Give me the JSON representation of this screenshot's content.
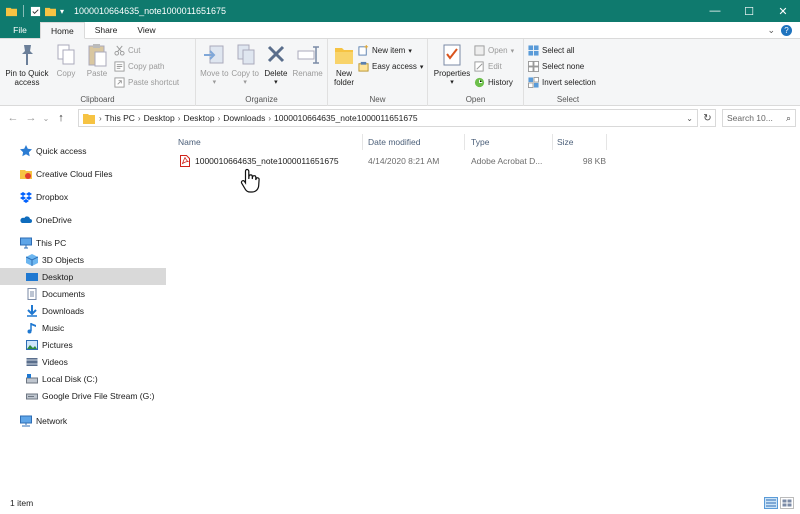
{
  "window": {
    "title": "1000010664635_note1000011651675",
    "minimize": "—",
    "maximize": "☐",
    "close": "✕"
  },
  "ribbon_tabs": [
    "File",
    "Home",
    "Share",
    "View"
  ],
  "ribbon": {
    "clipboard": {
      "label": "Clipboard",
      "pin": "Pin to Quick access",
      "copy": "Copy",
      "paste": "Paste",
      "cut": "Cut",
      "copy_path": "Copy path",
      "paste_shortcut": "Paste shortcut"
    },
    "organize": {
      "label": "Organize",
      "move_to": "Move to",
      "copy_to": "Copy to",
      "delete": "Delete",
      "rename": "Rename"
    },
    "new": {
      "label": "New",
      "new_folder": "New folder",
      "new_item": "New item",
      "easy_access": "Easy access"
    },
    "open": {
      "label": "Open",
      "properties": "Properties",
      "open": "Open",
      "edit": "Edit",
      "history": "History"
    },
    "select": {
      "label": "Select",
      "select_all": "Select all",
      "select_none": "Select none",
      "invert_selection": "Invert selection"
    }
  },
  "address": {
    "crumbs": [
      "This PC",
      "Desktop",
      "Desktop",
      "Downloads",
      "1000010664635_note1000011651675"
    ],
    "search_placeholder": "Search 10..."
  },
  "sidebar": {
    "items": [
      {
        "label": "Quick access"
      },
      {
        "label": "Creative Cloud Files"
      },
      {
        "label": "Dropbox"
      },
      {
        "label": "OneDrive"
      },
      {
        "label": "This PC"
      },
      {
        "label": "3D Objects"
      },
      {
        "label": "Desktop"
      },
      {
        "label": "Documents"
      },
      {
        "label": "Downloads"
      },
      {
        "label": "Music"
      },
      {
        "label": "Pictures"
      },
      {
        "label": "Videos"
      },
      {
        "label": "Local Disk (C:)"
      },
      {
        "label": "Google Drive File Stream (G:)"
      },
      {
        "label": "Network"
      }
    ]
  },
  "columns": {
    "name": "Name",
    "date": "Date modified",
    "type": "Type",
    "size": "Size"
  },
  "files": [
    {
      "name": "1000010664635_note1000011651675",
      "date": "4/14/2020 8:21 AM",
      "type": "Adobe Acrobat D...",
      "size": "98 KB"
    }
  ],
  "status": {
    "count": "1 item"
  },
  "colors": {
    "titlebar": "#0f7a6e",
    "selection": "#d9d9d9",
    "folder": "#f6c343",
    "pdf": "#d0241b"
  }
}
